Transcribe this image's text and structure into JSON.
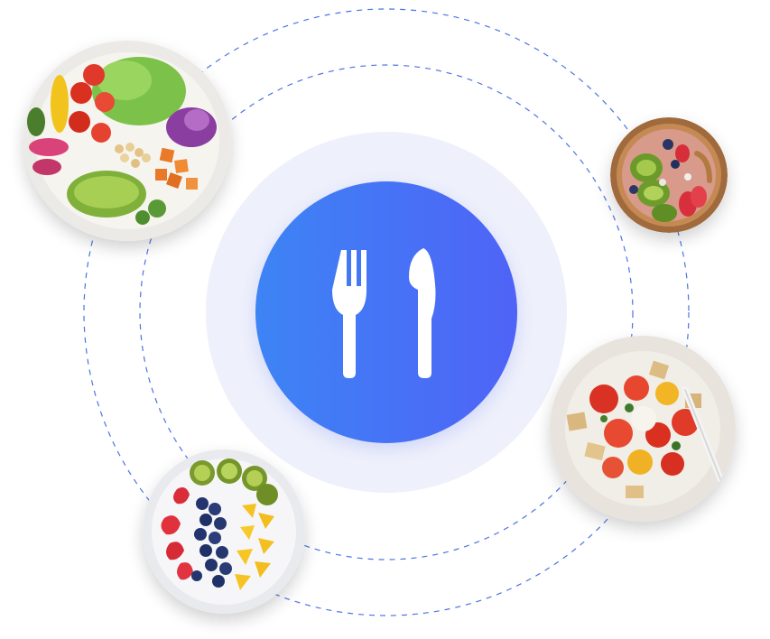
{
  "scene": {
    "accent_gradient": [
      "#3d84f5",
      "#4f63f6"
    ],
    "halo_color": "#eef0fb",
    "orbit_color": "#4b74e0",
    "center_icon": "fork-knife-icon",
    "dishes": [
      "veggie-buddha-bowl",
      "kiwi-berry-smoothie-bowl",
      "tomato-bread-salad-plate",
      "fruit-plate"
    ]
  }
}
